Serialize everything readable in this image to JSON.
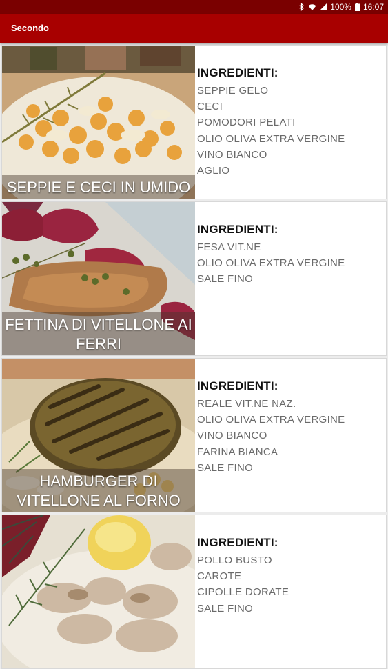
{
  "status_bar": {
    "battery": "100%",
    "time": "16:07",
    "icons": [
      "bluetooth-icon",
      "wifi-icon",
      "signal-icon",
      "battery-icon"
    ]
  },
  "app_bar": {
    "title": "Secondo"
  },
  "recipes": [
    {
      "name": "SEPPIE E CECI IN UMIDO",
      "ingredients_label": "INGREDIENTI:",
      "ingredients": [
        "SEPPIE GELO",
        "CECI",
        "POMODORI PELATI",
        "OLIO OLIVA EXTRA VERGINE",
        "VINO BIANCO",
        "AGLIO"
      ]
    },
    {
      "name": "FETTINA DI VITELLONE AI FERRI",
      "ingredients_label": "INGREDIENTI:",
      "ingredients": [
        "FESA VIT.NE",
        "OLIO OLIVA EXTRA VERGINE",
        "SALE FINO"
      ]
    },
    {
      "name": "HAMBURGER DI VITELLONE AL FORNO",
      "ingredients_label": "INGREDIENTI:",
      "ingredients": [
        "REALE VIT.NE NAZ.",
        "OLIO OLIVA EXTRA VERGINE",
        "VINO BIANCO",
        "FARINA BIANCA",
        "SALE FINO"
      ]
    },
    {
      "name": "",
      "ingredients_label": "INGREDIENTI:",
      "ingredients": [
        "POLLO BUSTO",
        "CAROTE",
        "CIPOLLE DORATE",
        "SALE FINO"
      ]
    }
  ]
}
